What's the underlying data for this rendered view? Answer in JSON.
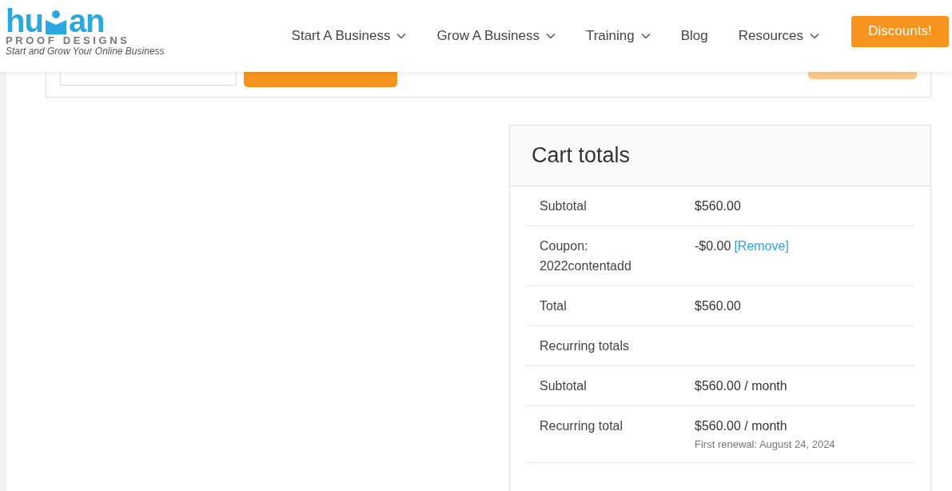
{
  "header": {
    "logo": {
      "word_start": "hu",
      "word_end": "an",
      "subtitle": "PROOF DESIGNS",
      "tagline": "Start and Grow Your Online Business"
    },
    "nav": [
      {
        "label": "Start A Business",
        "has_menu": true
      },
      {
        "label": "Grow A Business",
        "has_menu": true
      },
      {
        "label": "Training",
        "has_menu": true
      },
      {
        "label": "Blog",
        "has_menu": false
      },
      {
        "label": "Resources",
        "has_menu": true
      }
    ],
    "cta": "Discounts!"
  },
  "coupon": {
    "update_button": {
      "disabled": true
    }
  },
  "cart_totals": {
    "title": "Cart totals",
    "rows": [
      {
        "label": "Subtotal",
        "value": "$560.00"
      },
      {
        "label": "Coupon: 2022contentadd",
        "value": "-$0.00",
        "link": "[Remove]"
      },
      {
        "label": "Total",
        "value": "$560.00"
      },
      {
        "label": "Recurring totals"
      },
      {
        "label": "Subtotal",
        "value": "$560.00 / month"
      },
      {
        "label": "Recurring total",
        "value": "$560.00 / month",
        "note": "First renewal: August 24, 2024"
      }
    ]
  }
}
